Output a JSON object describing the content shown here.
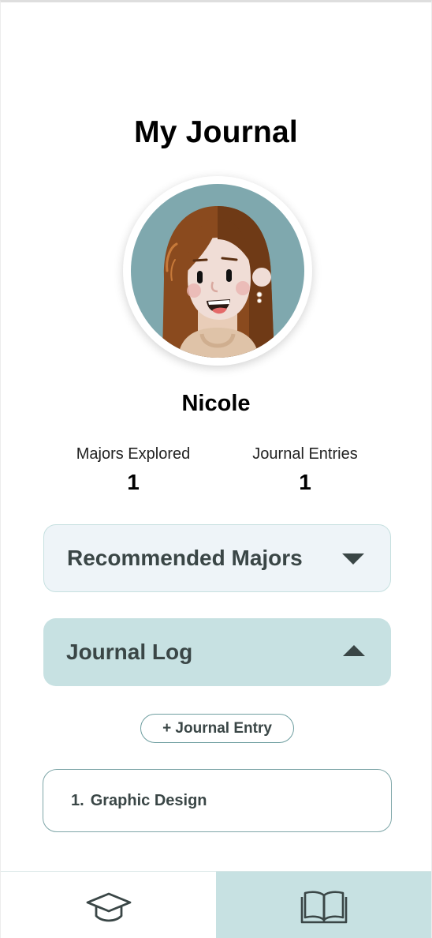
{
  "page": {
    "title": "My Journal"
  },
  "profile": {
    "name": "Nicole",
    "avatar": "woman-avatar-illustration"
  },
  "stats": [
    {
      "label": "Majors Explored",
      "value": "1"
    },
    {
      "label": "Journal Entries",
      "value": "1"
    }
  ],
  "sections": {
    "recommended": {
      "label": "Recommended Majors",
      "expanded": false,
      "icon": "caret-down-icon"
    },
    "journal_log": {
      "label": "Journal Log",
      "expanded": true,
      "icon": "caret-up-icon"
    }
  },
  "add_entry_label": "+ Journal Entry",
  "entries": [
    {
      "number": "1.",
      "title": "Graphic Design"
    }
  ],
  "nav": [
    {
      "name": "majors",
      "icon": "graduation-cap-icon",
      "active": false
    },
    {
      "name": "journal",
      "icon": "open-book-icon",
      "active": true
    }
  ],
  "colors": {
    "accent": "#c7e1e2",
    "accordion_collapsed_bg": "#eef4f8",
    "text_dark": "#3a4646",
    "avatar_bg": "#7fa8ae"
  }
}
